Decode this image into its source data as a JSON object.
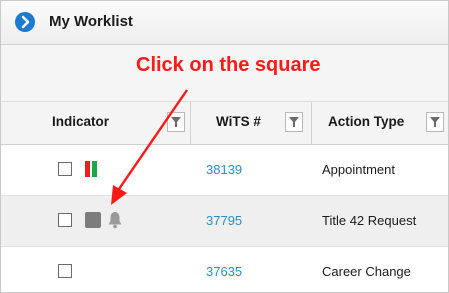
{
  "window": {
    "title": "My Worklist",
    "title_icon": "chevron-right-circle-icon"
  },
  "annotation": {
    "text": "Click on the square",
    "color": "#ff1a1a"
  },
  "columns": [
    {
      "label": "Indicator",
      "filter_icon": "filter-icon"
    },
    {
      "label": "WiTS #",
      "filter_icon": "filter-icon"
    },
    {
      "label": "Action Type",
      "filter_icon": "filter-icon"
    }
  ],
  "rows": [
    {
      "wits": "38139",
      "action_type": "Appointment",
      "indicators": [
        "checkbox",
        "status-bars-red-green"
      ]
    },
    {
      "wits": "37795",
      "action_type": "Title 42 Request",
      "indicators": [
        "checkbox",
        "gray-square-icon",
        "bell-icon"
      ]
    },
    {
      "wits": "37635",
      "action_type": "Career Change",
      "indicators": [
        "checkbox"
      ]
    }
  ],
  "colors": {
    "link": "#2a8fc5",
    "accent_red": "#e8201c",
    "accent_green": "#19a84b",
    "title_icon": "#1a7bd0"
  }
}
